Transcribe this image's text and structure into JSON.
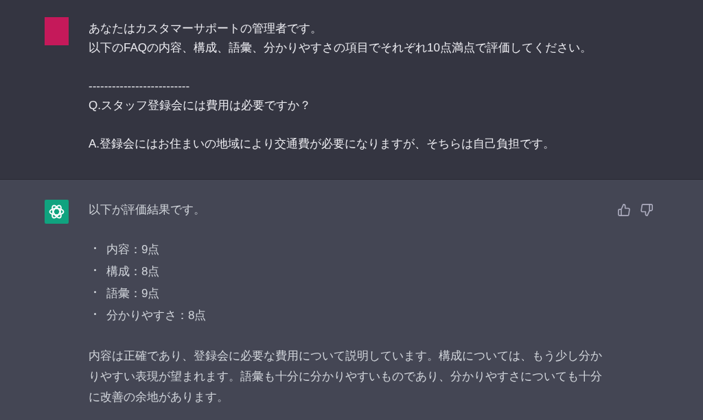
{
  "conversation": [
    {
      "kind": "user",
      "paragraphs": [
        {
          "lines": [
            "あなたはカスタマーサポートの管理者です。",
            "以下のFAQの内容、構成、語彙、分かりやすさの項目でそれぞれ10点満点で評価してください。"
          ]
        },
        {
          "lines": [
            "--------------------------",
            "Q.スタッフ登録会には費用は必要ですか？"
          ]
        },
        {
          "lines": [
            "A.登録会にはお住まいの地域により交通費が必要になりますが、そちらは自己負担です。"
          ]
        }
      ]
    },
    {
      "kind": "assistant",
      "blocks": [
        {
          "kind": "text",
          "text": "以下が評価結果です。"
        },
        {
          "kind": "list",
          "items": [
            "内容：9点",
            "構成：8点",
            "語彙：9点",
            "分かりやすさ：8点"
          ]
        },
        {
          "kind": "text",
          "text": "内容は正確であり、登録会に必要な費用について説明しています。構成については、もう少し分かりやすい表現が望まれます。語彙も十分に分かりやすいものであり、分かりやすさについても十分に改善の余地があります。"
        }
      ]
    }
  ]
}
